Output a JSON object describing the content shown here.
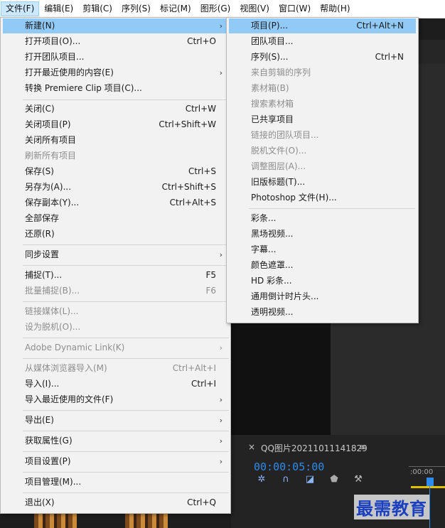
{
  "menubar": {
    "items": [
      "文件(F)",
      "编辑(E)",
      "剪辑(C)",
      "序列(S)",
      "标记(M)",
      "图形(G)",
      "视图(V)",
      "窗口(W)",
      "帮助(H)"
    ]
  },
  "file_menu": {
    "new": {
      "label": "新建(N)"
    },
    "open_project": {
      "label": "打开项目(O)...",
      "shortcut": "Ctrl+O"
    },
    "open_team_project": {
      "label": "打开团队项目..."
    },
    "open_recent": {
      "label": "打开最近使用的内容(E)"
    },
    "convert_premiere_clip": {
      "label": "转换 Premiere Clip 项目(C)..."
    },
    "close": {
      "label": "关闭(C)",
      "shortcut": "Ctrl+W"
    },
    "close_project": {
      "label": "关闭项目(P)",
      "shortcut": "Ctrl+Shift+W"
    },
    "close_all_projects": {
      "label": "关闭所有项目"
    },
    "refresh_all_projects": {
      "label": "刷新所有项目"
    },
    "save": {
      "label": "保存(S)",
      "shortcut": "Ctrl+S"
    },
    "save_as": {
      "label": "另存为(A)...",
      "shortcut": "Ctrl+Shift+S"
    },
    "save_copy": {
      "label": "保存副本(Y)...",
      "shortcut": "Ctrl+Alt+S"
    },
    "save_all": {
      "label": "全部保存"
    },
    "revert": {
      "label": "还原(R)"
    },
    "sync_settings": {
      "label": "同步设置"
    },
    "capture": {
      "label": "捕捉(T)...",
      "shortcut": "F5"
    },
    "batch_capture": {
      "label": "批量捕捉(B)...",
      "shortcut": "F6"
    },
    "link_media": {
      "label": "链接媒体(L)..."
    },
    "make_offline": {
      "label": "设为脱机(O)..."
    },
    "dynamic_link": {
      "label": "Adobe Dynamic Link(K)"
    },
    "import_from_browser": {
      "label": "从媒体浏览器导入(M)",
      "shortcut": "Ctrl+Alt+I"
    },
    "import": {
      "label": "导入(I)...",
      "shortcut": "Ctrl+I"
    },
    "import_recent": {
      "label": "导入最近使用的文件(F)"
    },
    "export": {
      "label": "导出(E)"
    },
    "get_properties": {
      "label": "获取属性(G)"
    },
    "project_settings": {
      "label": "项目设置(P)"
    },
    "project_manager": {
      "label": "项目管理(M)..."
    },
    "exit": {
      "label": "退出(X)",
      "shortcut": "Ctrl+Q"
    }
  },
  "new_submenu": {
    "project": {
      "label": "项目(P)...",
      "shortcut": "Ctrl+Alt+N"
    },
    "team_project": {
      "label": "团队项目..."
    },
    "sequence": {
      "label": "序列(S)...",
      "shortcut": "Ctrl+N"
    },
    "sequence_from_clip": {
      "label": "来自剪辑的序列"
    },
    "bin": {
      "label": "素材箱(B)"
    },
    "search_bin": {
      "label": "搜索素材箱"
    },
    "shared_project": {
      "label": "已共享项目"
    },
    "linked_team_project": {
      "label": "链接的团队项目..."
    },
    "offline_file": {
      "label": "脱机文件(O)..."
    },
    "adjustment_layer": {
      "label": "调整图层(A)..."
    },
    "legacy_title": {
      "label": "旧版标题(T)..."
    },
    "photoshop_file": {
      "label": "Photoshop 文件(H)..."
    },
    "bars_and_tone": {
      "label": "彩条..."
    },
    "black_video": {
      "label": "黑场视频..."
    },
    "captions": {
      "label": "字幕..."
    },
    "color_matte": {
      "label": "颜色遮罩..."
    },
    "hd_bars": {
      "label": "HD 彩条..."
    },
    "countdown_leader": {
      "label": "通用倒计时片头..."
    },
    "transparent_video": {
      "label": "透明视频..."
    }
  },
  "timeline": {
    "close_glyph": "×",
    "sequence_name": "QQ图片20211011141829",
    "menu_glyph": "≡",
    "timecode": "00:00:05:00",
    "ruler_label": ":00:00"
  },
  "watermark": "最需教育",
  "arrow_glyph": "›",
  "colors": {
    "highlight": "#91c9f7",
    "menubar_active": "#cce8ff",
    "timecode": "#2d8ceb",
    "watermark": "#1a3fbf"
  }
}
